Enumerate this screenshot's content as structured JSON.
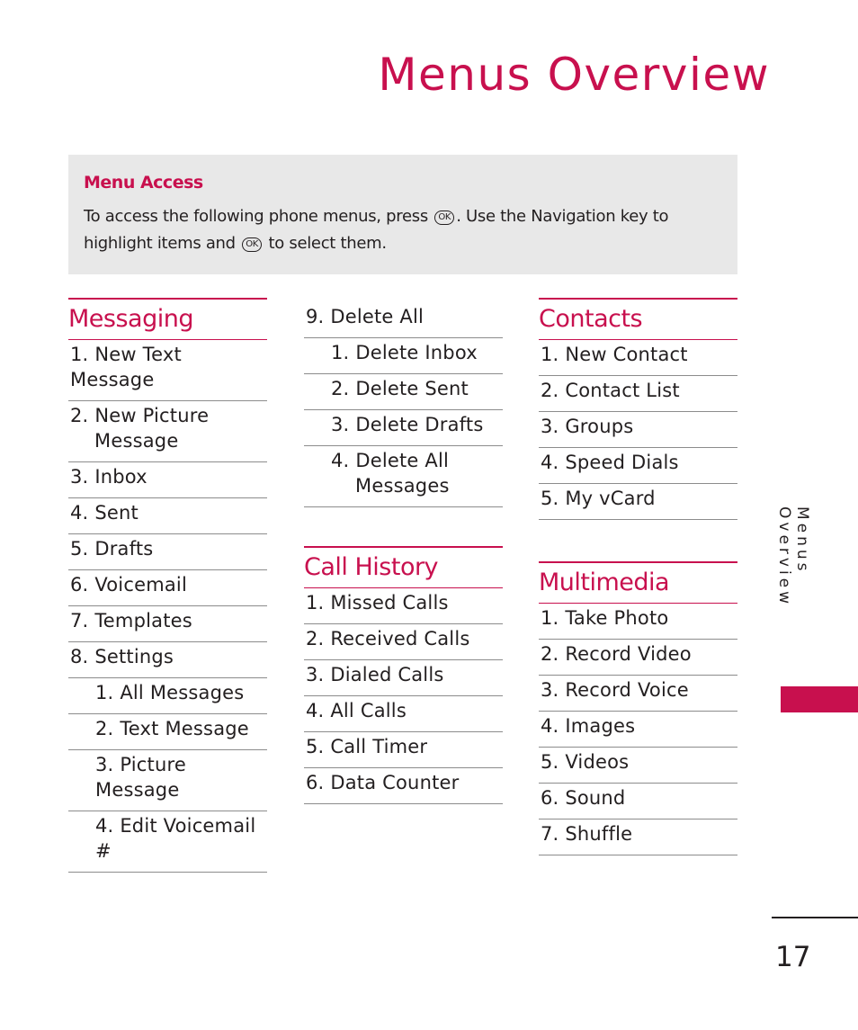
{
  "page": {
    "title": "Menus Overview",
    "side_label": "Menus Overview",
    "page_number": "17",
    "accent_color": "#c8104e"
  },
  "access": {
    "heading": "Menu Access",
    "line1_a": "To access the following phone menus, press",
    "ok_key": "OK",
    "line1_b": ". Use the Navigation key to",
    "line2_a": "highlight items and",
    "line2_b": "to select them."
  },
  "messaging": {
    "heading": "Messaging",
    "items": [
      {
        "num": "1.",
        "label": "New Text Message"
      },
      {
        "num": "2.",
        "label": "New Picture",
        "label2": "Message"
      },
      {
        "num": "3.",
        "label": "Inbox"
      },
      {
        "num": "4.",
        "label": "Sent"
      },
      {
        "num": "5.",
        "label": "Drafts"
      },
      {
        "num": "6.",
        "label": "Voicemail"
      },
      {
        "num": "7.",
        "label": "Templates"
      },
      {
        "num": "8.",
        "label": "Settings"
      }
    ],
    "settings_sub": [
      {
        "num": "1.",
        "label": "All Messages"
      },
      {
        "num": "2.",
        "label": "Text Message"
      },
      {
        "num": "3.",
        "label": "Picture Message"
      },
      {
        "num": "4.",
        "label": "Edit Voicemail #"
      }
    ],
    "delete_all": {
      "num": "9.",
      "label": "Delete All"
    },
    "delete_sub": [
      {
        "num": "1.",
        "label": "Delete Inbox"
      },
      {
        "num": "2.",
        "label": "Delete Sent"
      },
      {
        "num": "3.",
        "label": "Delete Drafts"
      },
      {
        "num": "4.",
        "label": "Delete All",
        "label2": "Messages"
      }
    ]
  },
  "call_history": {
    "heading": "Call History",
    "items": [
      {
        "num": "1.",
        "label": "Missed Calls"
      },
      {
        "num": "2.",
        "label": "Received Calls"
      },
      {
        "num": "3.",
        "label": "Dialed Calls"
      },
      {
        "num": "4.",
        "label": "All Calls"
      },
      {
        "num": "5.",
        "label": "Call Timer"
      },
      {
        "num": "6.",
        "label": "Data Counter"
      }
    ]
  },
  "contacts": {
    "heading": "Contacts",
    "items": [
      {
        "num": "1.",
        "label": "New Contact"
      },
      {
        "num": "2.",
        "label": "Contact List"
      },
      {
        "num": "3.",
        "label": "Groups"
      },
      {
        "num": "4.",
        "label": "Speed Dials"
      },
      {
        "num": "5.",
        "label": "My vCard"
      }
    ]
  },
  "multimedia": {
    "heading": "Multimedia",
    "items": [
      {
        "num": "1.",
        "label": "Take Photo"
      },
      {
        "num": "2.",
        "label": "Record Video"
      },
      {
        "num": "3.",
        "label": "Record Voice"
      },
      {
        "num": "4.",
        "label": "Images"
      },
      {
        "num": "5.",
        "label": "Videos"
      },
      {
        "num": "6.",
        "label": "Sound"
      },
      {
        "num": "7.",
        "label": "Shuffle"
      }
    ]
  }
}
